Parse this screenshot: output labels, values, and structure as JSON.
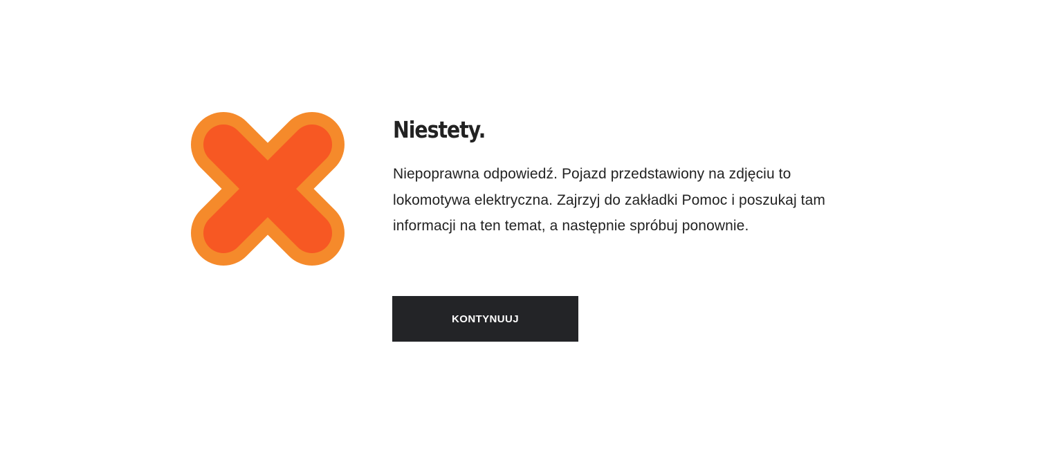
{
  "result": {
    "icon": "cross-icon",
    "title": "Niestety.",
    "message": "Niepoprawna odpowiedź. Pojazd przedstawiony na zdjęciu to lokomotywa elektryczna. Zajrzyj do zakładki Pomoc i poszukaj tam informacji na ten temat, a następnie spróbuj ponownie.",
    "continue_label": "KONTYNUUJ"
  },
  "colors": {
    "icon_outer": "#F58A2B",
    "icon_inner": "#F75823",
    "text": "#222222",
    "button_background": "#232427",
    "button_text": "#FFFFFF",
    "background": "#FFFFFF"
  }
}
